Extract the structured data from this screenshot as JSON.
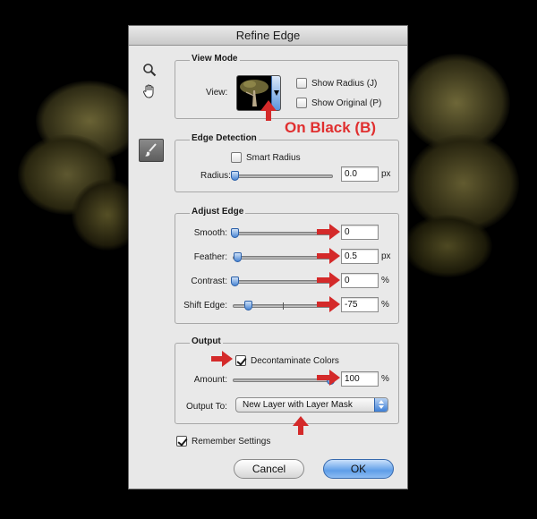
{
  "dialog": {
    "title": "Refine Edge"
  },
  "tools": {
    "zoom": "magnifier-icon",
    "hand": "hand-icon",
    "brush": "refine-radius-brush-icon"
  },
  "view_mode": {
    "legend": "View Mode",
    "view_label": "View:",
    "show_radius": {
      "label": "Show Radius (J)",
      "checked": false
    },
    "show_original": {
      "label": "Show Original (P)",
      "checked": false
    }
  },
  "annotation": {
    "text": "On Black (B)",
    "color": "#e02f2f"
  },
  "edge_detection": {
    "legend": "Edge Detection",
    "smart_radius": {
      "label": "Smart Radius",
      "checked": false
    },
    "radius": {
      "label": "Radius:",
      "value": "0.0",
      "unit": "px"
    }
  },
  "adjust_edge": {
    "legend": "Adjust Edge",
    "smooth": {
      "label": "Smooth:",
      "value": "0"
    },
    "feather": {
      "label": "Feather:",
      "value": "0.5",
      "unit": "px"
    },
    "contrast": {
      "label": "Contrast:",
      "value": "0",
      "unit": "%"
    },
    "shift_edge": {
      "label": "Shift Edge:",
      "value": "-75",
      "unit": "%"
    }
  },
  "output": {
    "legend": "Output",
    "decontaminate": {
      "label": "Decontaminate Colors",
      "checked": true
    },
    "amount": {
      "label": "Amount:",
      "value": "100",
      "unit": "%"
    },
    "output_to": {
      "label": "Output To:",
      "value": "New Layer with Layer Mask"
    }
  },
  "remember": {
    "label": "Remember Settings",
    "checked": true
  },
  "buttons": {
    "cancel": "Cancel",
    "ok": "OK"
  },
  "colors": {
    "accent": "#4a86d4",
    "annotation_red": "#d42a2a",
    "dialog_bg": "#e8e8e8"
  }
}
